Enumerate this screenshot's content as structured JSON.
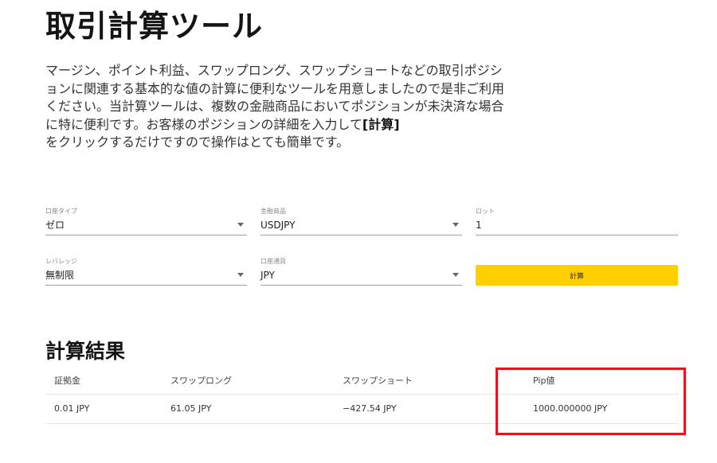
{
  "page": {
    "title": "取引計算ツール",
    "intro_text": "マージン、ポイント利益、スワップロング、スワップショートなどの取引ポジションに関連する基本的な値の計算に便利なツールを用意しましたので是非ご利用ください。当計算ツールは、複数の金融商品においてポジションが未決済な場合に特に便利です。お客様のポジションの詳細を入力して",
    "intro_bold": "[計算]",
    "intro_tail": "をクリックするだけですので操作はとても簡単です。"
  },
  "form": {
    "account_type": {
      "label": "口座タイプ",
      "value": "ゼロ"
    },
    "instrument": {
      "label": "金融商品",
      "value": "USDJPY"
    },
    "lot": {
      "label": "ロット",
      "value": "1"
    },
    "leverage": {
      "label": "レバレッジ",
      "value": "無制限"
    },
    "account_currency": {
      "label": "口座通貨",
      "value": "JPY"
    },
    "calculate_label": "計算"
  },
  "results": {
    "title": "計算結果",
    "headers": [
      "証拠金",
      "スワップロング",
      "スワップショート",
      "Pip値"
    ],
    "row": [
      "0.01 JPY",
      "61.05 JPY",
      "−427.54 JPY",
      "1000.000000 JPY"
    ]
  },
  "colors": {
    "button": "#ffcf00",
    "highlight": "#e3151f"
  }
}
